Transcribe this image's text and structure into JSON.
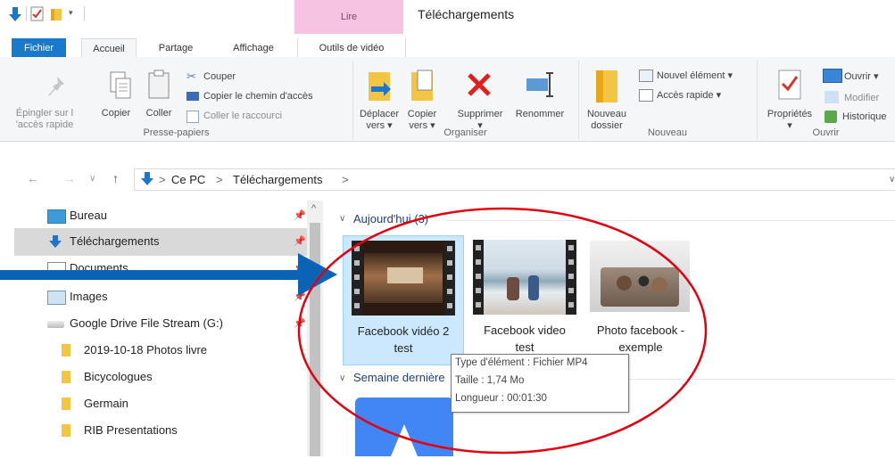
{
  "title_bar": {
    "context_tab": "Lire",
    "window_title": "Téléchargements"
  },
  "tabs": {
    "file": "Fichier",
    "home": "Accueil",
    "share": "Partage",
    "view": "Affichage",
    "video_tools": "Outils de vidéo"
  },
  "ribbon": {
    "clipboard": {
      "pin_label_1": "Épingler sur l",
      "pin_label_2": "'accès rapide",
      "copy": "Copier",
      "paste": "Coller",
      "cut": "Couper",
      "copy_path": "Copier le chemin d'accès",
      "paste_shortcut": "Coller le raccourci",
      "group": "Presse-papiers"
    },
    "organize": {
      "move_1": "Déplacer",
      "move_2": "vers ▾",
      "copy_1": "Copier",
      "copy_2": "vers ▾",
      "delete": "Supprimer",
      "rename": "Renommer",
      "group": "Organiser"
    },
    "new": {
      "new_folder_1": "Nouveau",
      "new_folder_2": "dossier",
      "new_item": "Nouvel élément ▾",
      "easy_access": "Accès rapide ▾",
      "group": "Nouveau"
    },
    "open": {
      "properties": "Propriétés",
      "open": "Ouvrir ▾",
      "edit": "Modifier",
      "history": "Historique",
      "group": "Ouvrir"
    }
  },
  "address": {
    "back": "←",
    "forward": "→",
    "recent": "∨",
    "up": "↑",
    "crumb1": "Ce PC",
    "sep1": ">",
    "crumb2": "Téléchargements",
    "sep2": ">",
    "sep0": ">",
    "dropdown": "∨"
  },
  "nav": {
    "items": [
      {
        "label": "Bureau",
        "pinned": true
      },
      {
        "label": "Téléchargements",
        "pinned": true,
        "selected": true
      },
      {
        "label": "Documents",
        "pinned": true
      },
      {
        "label": "Images",
        "pinned": true
      },
      {
        "label": "Google Drive File Stream (G:)",
        "pinned": true
      },
      {
        "label": "2019-10-18 Photos livre",
        "pinned": false
      },
      {
        "label": "Bicycologues",
        "pinned": false
      },
      {
        "label": "Germain",
        "pinned": false
      },
      {
        "label": "RIB Presentations",
        "pinned": false
      }
    ],
    "scroll_up": "^"
  },
  "content": {
    "group_today": "Aujourd'hui (3)",
    "group_last_week": "Semaine dernière",
    "chevron": "∨",
    "files": [
      {
        "line1": "Facebook vidéo 2",
        "line2": "test"
      },
      {
        "line1": "Facebook video",
        "line2": "test"
      },
      {
        "line1": "Photo facebook -",
        "line2": "exemple"
      }
    ],
    "tooltip": {
      "type": "Type d'élément : Fichier MP4",
      "size": "Taille : 1,74 Mo",
      "length": "Longueur : 00:01:30"
    }
  },
  "colors": {
    "accent": "#1979ca",
    "arrow": "#0b63b5",
    "annotation_circle": "#e3000f",
    "context_tab": "#f7c3e2",
    "selection": "#cce8ff"
  }
}
